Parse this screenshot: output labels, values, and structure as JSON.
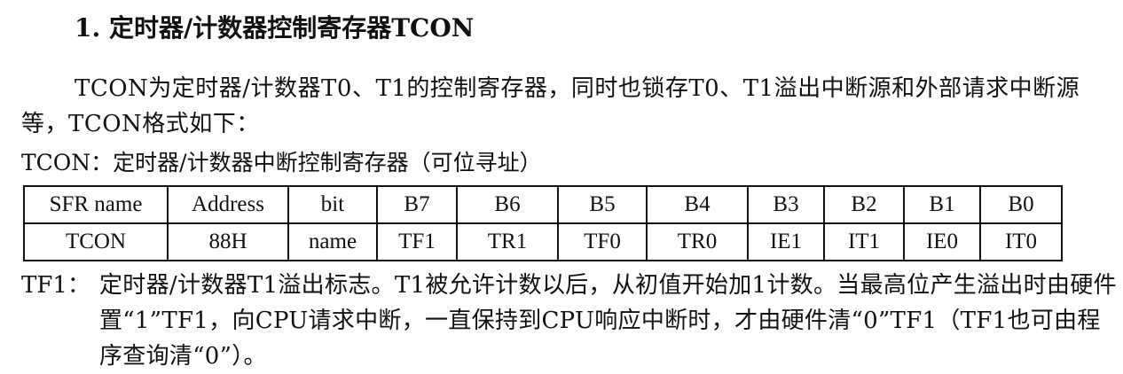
{
  "section": {
    "title": "1. 定时器/计数器控制寄存器TCON"
  },
  "intro": {
    "text": "TCON为定时器/计数器T0、T1的控制寄存器，同时也锁存T0、T1溢出中断源和外部请求中断源等，TCON格式如下："
  },
  "table_caption": "TCON：定时器/计数器中断控制寄存器（可位寻址）",
  "table": {
    "header": [
      "SFR name",
      "Address",
      "bit",
      "B7",
      "B6",
      "B5",
      "B4",
      "B3",
      "B2",
      "B1",
      "B0"
    ],
    "row": [
      "TCON",
      "88H",
      "name",
      "TF1",
      "TR1",
      "TF0",
      "TR0",
      "IE1",
      "IT1",
      "IE0",
      "IT0"
    ]
  },
  "tf1_description": {
    "term": "TF1：",
    "text": "定时器/计数器T1溢出标志。T1被允许计数以后，从初值开始加1计数。当最高位产生溢出时由硬件置“1”TF1，向CPU请求中断，一直保持到CPU响应中断时，才由硬件清“0”TF1（TF1也可由程序查询清“0”）。"
  }
}
